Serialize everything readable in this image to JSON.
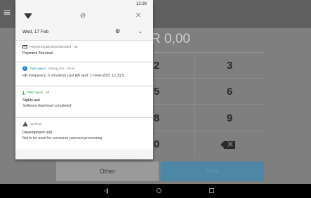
{
  "status": {
    "clock": "12:38"
  },
  "quick_settings": {
    "wifi_icon": "wifi-icon",
    "dnd_icon": "do-not-disturb-icon",
    "bluetooth_icon": "bluetooth-off-icon"
  },
  "shade_header": {
    "date": "Wed, 17 Feb",
    "settings_icon": "gear-icon",
    "expand_icon": "chevron-down-icon"
  },
  "notifications": [
    {
      "app": "PaymentApplicationStandard",
      "time": "3d",
      "app_icon": "card-icon",
      "title": "Payment Terminal",
      "text": ""
    },
    {
      "app": "TMS Agent",
      "channel": "Debug Info",
      "time": "4m",
      "app_icon": "info-icon",
      "title": "",
      "text": "HB Frequency: 5 minute(s) Last HB sent: 17-Feb-2021 12:33:5.."
    },
    {
      "app": "TMS Agent",
      "time": "2d",
      "app_icon": "download-icon",
      "title": "Sights.apk",
      "text": "Software download completed"
    },
    {
      "app": "Verifone",
      "time": "",
      "app_icon": "warning-icon",
      "title": "Development unit",
      "text": "Not to be used for consumer payment processing"
    }
  ],
  "clear_all_label": "CLEAR ALL",
  "app": {
    "amount": "R 0,00",
    "keys": [
      "2",
      "3",
      "5",
      "6",
      "8",
      "9",
      "0"
    ],
    "other_button": "Other",
    "pay_button": "R 0,00"
  },
  "nav": {
    "back_icon": "back-icon",
    "home_icon": "home-icon",
    "recents_icon": "recents-icon"
  },
  "colors": {
    "accent_blue": "#1e88c8",
    "download_green": "#2e9a3c",
    "pay_button": "#4e87a6"
  }
}
